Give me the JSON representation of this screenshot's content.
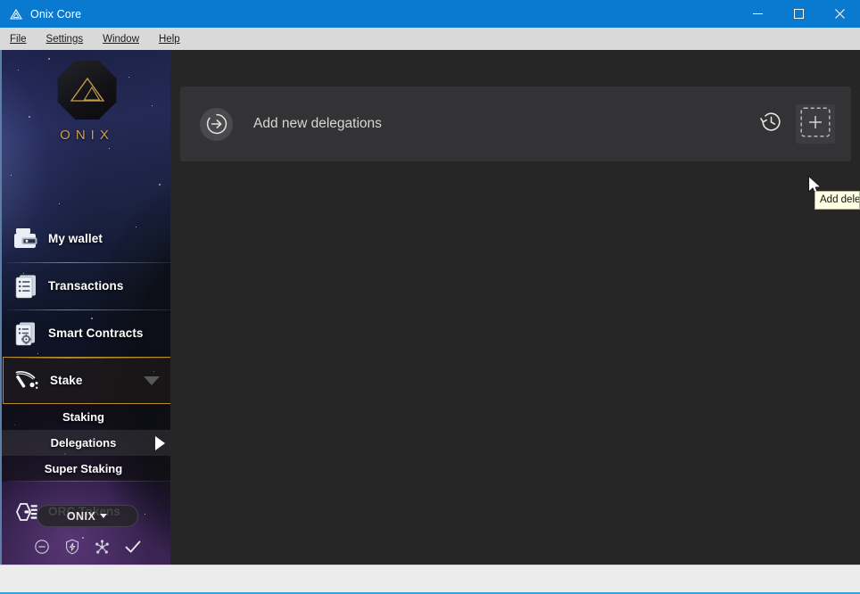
{
  "window": {
    "title": "Onix Core",
    "app_icon": "onix-triangle-icon",
    "minimize_label": "–",
    "maximize_label": "□",
    "close_label": "✕"
  },
  "menubar": {
    "items": [
      {
        "label": "File",
        "accel": "F"
      },
      {
        "label": "Settings",
        "accel": "S"
      },
      {
        "label": "Window",
        "accel": "W"
      },
      {
        "label": "Help",
        "accel": "H"
      }
    ]
  },
  "sidebar": {
    "logo_text": "ONIX",
    "logo_icon": "onix-octagon-logo",
    "nav": [
      {
        "label": "My wallet",
        "icon": "wallet-icon",
        "active": false
      },
      {
        "label": "Transactions",
        "icon": "transactions-list-icon",
        "active": false
      },
      {
        "label": "Smart Contracts",
        "icon": "smart-contract-icon",
        "active": false
      },
      {
        "label": "Stake",
        "icon": "pickaxe-icon",
        "active": true,
        "expanded": true
      }
    ],
    "submenu": [
      {
        "label": "Staking",
        "selected": false
      },
      {
        "label": "Delegations",
        "selected": true
      },
      {
        "label": "Super Staking",
        "selected": false
      }
    ],
    "nav_after": [
      {
        "label": "ORC Tokens",
        "icon": "orc-token-hex-icon",
        "active": false
      }
    ],
    "unit_selector": {
      "label": "ONIX",
      "caret": "caret-down-icon"
    },
    "status_icons": [
      {
        "name": "no-connection-icon"
      },
      {
        "name": "shield-bolt-icon"
      },
      {
        "name": "network-nodes-icon"
      },
      {
        "name": "sync-check-icon"
      }
    ]
  },
  "main": {
    "card": {
      "leading_icon": "arrow-right-circle-icon",
      "title": "Add new delegations",
      "history_button": {
        "icon": "history-clock-icon"
      },
      "add_button": {
        "icon": "plus-icon",
        "hovered": true
      }
    },
    "tooltip": {
      "text": "Add delegation"
    },
    "annotation": {
      "type": "red-arrow",
      "color": "#e00000"
    }
  },
  "colors": {
    "titlebar": "#0a7ad1",
    "menubar": "#d9d9d9",
    "content_bg": "#262626",
    "card_bg": "#333335",
    "accent_gold": "#b98a2e",
    "logo_gold": "#d49b4a",
    "statusbar": "#ececec",
    "statusbar_accent": "#3ea0d8"
  }
}
